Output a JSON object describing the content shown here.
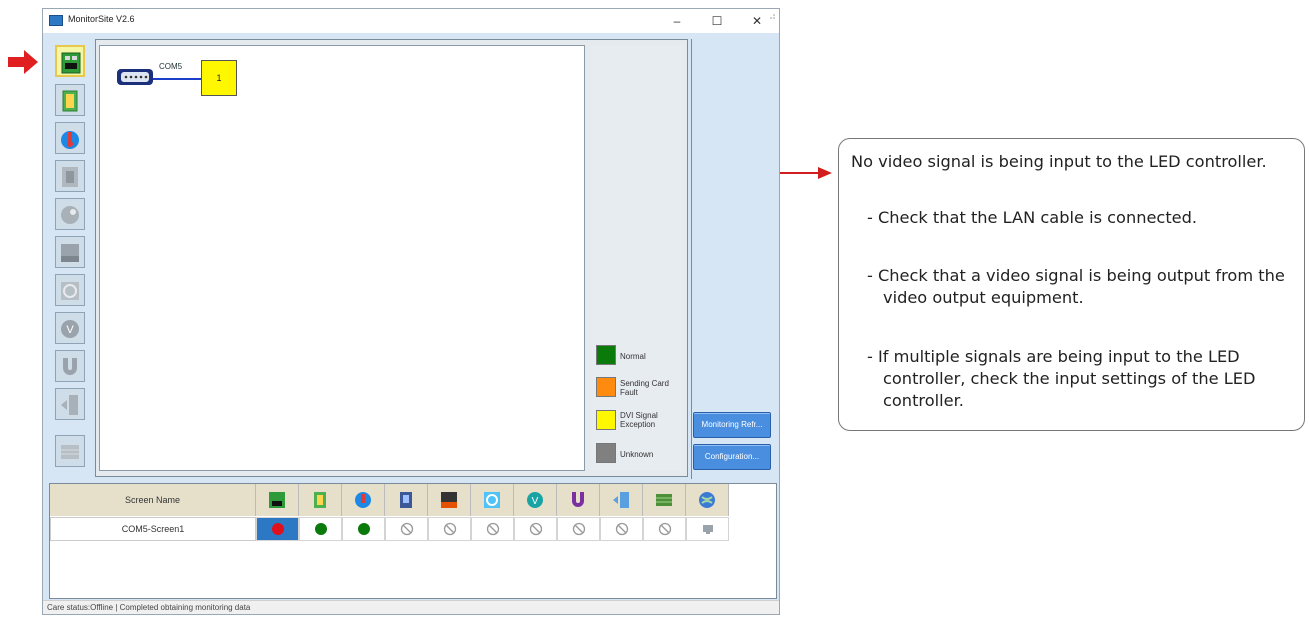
{
  "window": {
    "title": "MonitorSite V2.6",
    "controls": {
      "minimize": "–",
      "maximize": "☐",
      "close": "✕"
    }
  },
  "sidebar": {
    "items": [
      {
        "icon": "receiving-card-icon",
        "active": true
      },
      {
        "icon": "module-icon",
        "active": false
      },
      {
        "icon": "temperature-icon",
        "active": false
      },
      {
        "icon": "humidity-icon",
        "active": false
      },
      {
        "icon": "smoke-icon",
        "active": false
      },
      {
        "icon": "heat-icon",
        "active": false
      },
      {
        "icon": "fan-icon",
        "active": false
      },
      {
        "icon": "voltage-icon",
        "active": false
      },
      {
        "icon": "magnet-icon",
        "active": false
      },
      {
        "icon": "door-icon",
        "active": false
      },
      {
        "icon": "led-panel-icon",
        "active": false
      }
    ]
  },
  "topology": {
    "port_label": "COM5",
    "controller_label": "1"
  },
  "legend": [
    {
      "label": "Normal",
      "color": "#0a7a0a"
    },
    {
      "label": "Sending Card Fault",
      "color": "#ff8a10"
    },
    {
      "label": "DVI Signal Exception",
      "color": "#fff700"
    },
    {
      "label": "Unknown",
      "color": "#808080"
    }
  ],
  "buttons": {
    "monitoring": "Monitoring Refr...",
    "configuration": "Configuration..."
  },
  "table": {
    "header_name": "Screen Name",
    "row_name": "COM5-Screen1",
    "column_icons": [
      "receiving-card-icon",
      "module-icon",
      "temperature-icon",
      "humidity-icon",
      "smoke-icon",
      "fan-icon",
      "voltage-icon",
      "magnet-icon",
      "door-icon",
      "led-panel-icon",
      "globe-icon"
    ],
    "row_status": [
      "red-dot",
      "green-dot",
      "green-dot",
      "disabled",
      "disabled",
      "disabled",
      "disabled",
      "disabled",
      "disabled",
      "disabled",
      "monitor-gray"
    ]
  },
  "status_bar": "Care status:Offline  |  Completed obtaining monitoring data",
  "callout": {
    "main": "No video signal is being input to the LED controller.",
    "bullets": [
      "- Check that the LAN cable is connected.",
      "- Check that a video signal is being output from the video output equipment.",
      "- If multiple signals are being input to the LED controller, check the input settings of the LED controller."
    ]
  },
  "colors": {
    "accent_red": "#e02020",
    "status_red": "#e0101c",
    "status_green": "#0a7a0a",
    "button_blue": "#4a8ee0"
  }
}
